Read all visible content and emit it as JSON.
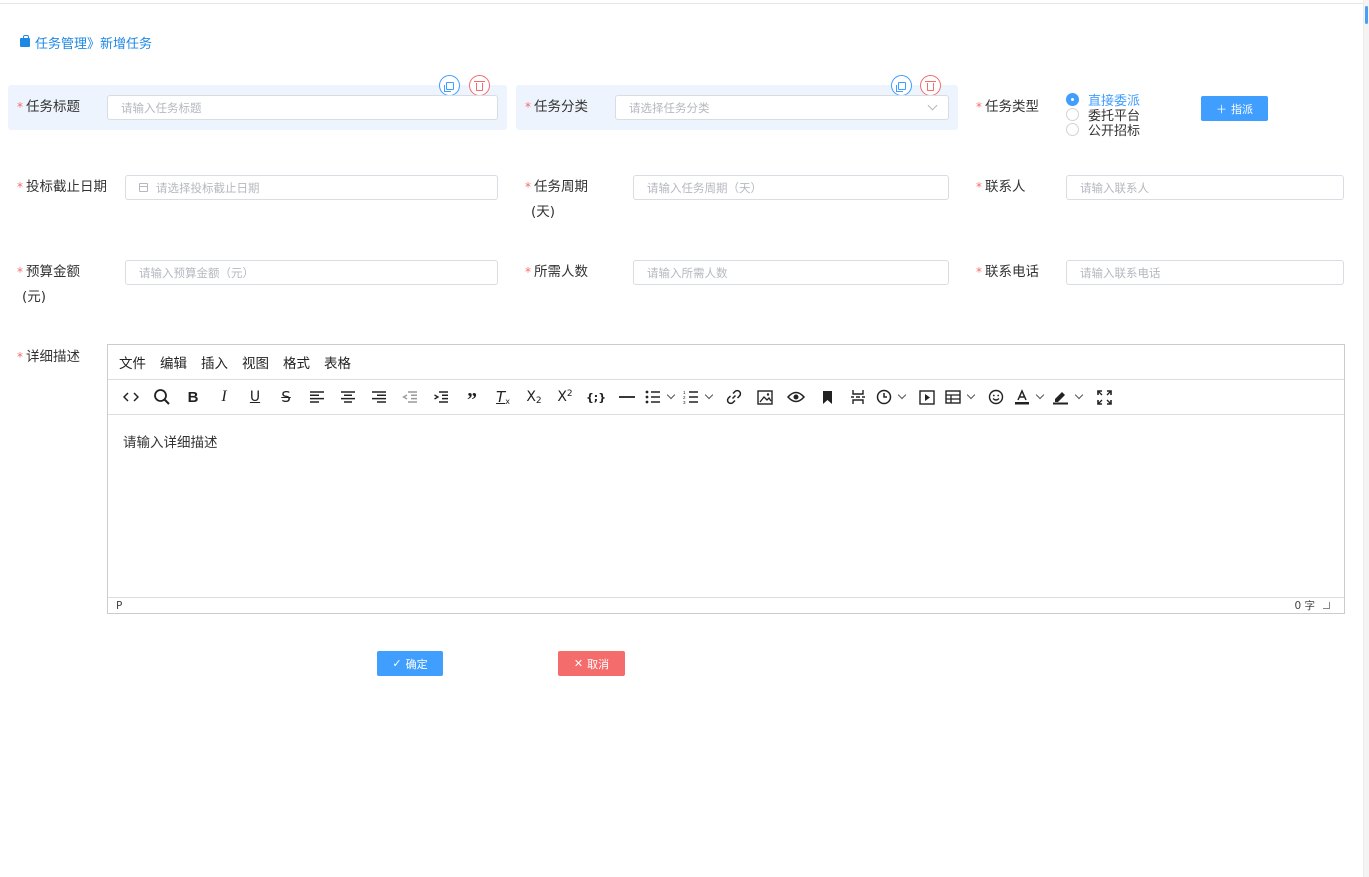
{
  "breadcrumb": {
    "section": "任务管理",
    "separator": "》",
    "current": "新增任务"
  },
  "form": {
    "task_title": {
      "label": "任务标题",
      "placeholder": "请输入任务标题"
    },
    "task_category": {
      "label": "任务分类",
      "placeholder": "请选择任务分类"
    },
    "task_type": {
      "label": "任务类型",
      "options": [
        {
          "label": "直接委派",
          "checked": true
        },
        {
          "label": "委托平台",
          "checked": false
        },
        {
          "label": "公开招标",
          "checked": false
        }
      ],
      "assign_button": "指派"
    },
    "bid_deadline": {
      "label": "投标截止日期",
      "placeholder": "请选择投标截止日期"
    },
    "task_period": {
      "label_line1": "任务周期",
      "label_line2": "(天)",
      "placeholder": "请输入任务周期（天）"
    },
    "contact_person": {
      "label": "联系人",
      "placeholder": "请输入联系人"
    },
    "budget": {
      "label_line1": "预算金额",
      "label_line2": "(元)",
      "placeholder": "请输入预算金额（元）"
    },
    "people_needed": {
      "label": "所需人数",
      "placeholder": "请输入所需人数"
    },
    "contact_phone": {
      "label": "联系电话",
      "placeholder": "请输入联系电话"
    },
    "description": {
      "label": "详细描述"
    },
    "required_mark": "*"
  },
  "editor": {
    "menus": [
      "文件",
      "编辑",
      "插入",
      "视图",
      "格式",
      "表格"
    ],
    "placeholder": "请输入详细描述",
    "status_path": "P",
    "word_count": "0 字"
  },
  "actions": {
    "confirm": "确定",
    "cancel": "取消"
  },
  "colors": {
    "primary": "#409eff",
    "danger": "#f56c6c",
    "link": "#1e88e5"
  }
}
